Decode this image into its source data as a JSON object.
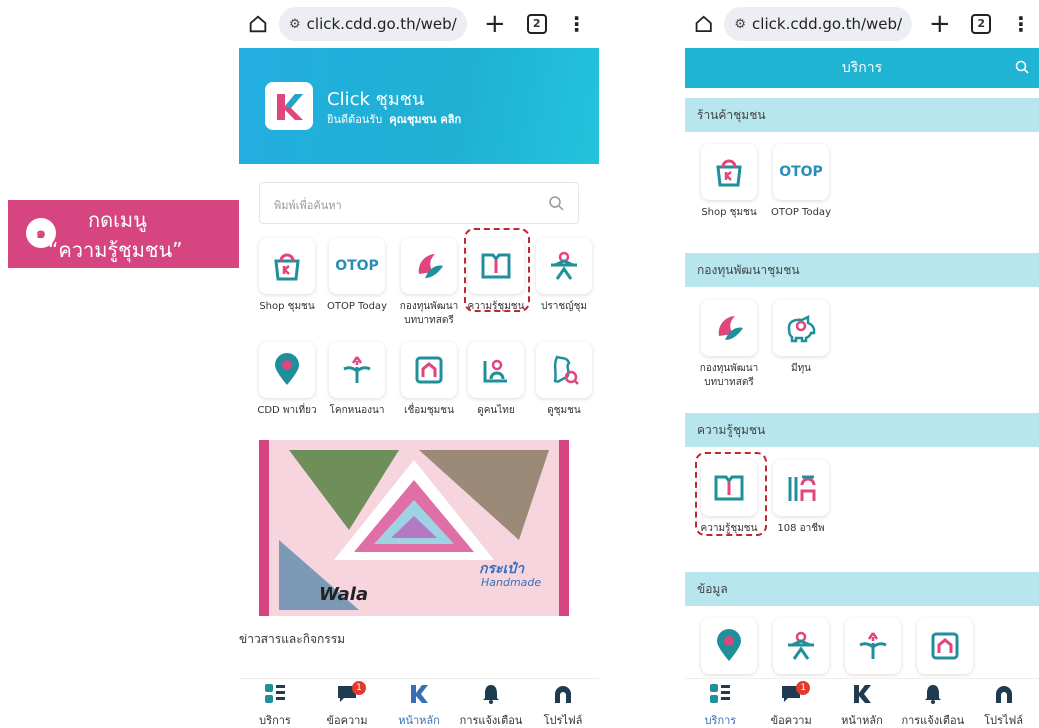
{
  "annotation": {
    "step": "๑",
    "line1": "กดเมนู",
    "line2": "“ความรู้ชุมชน”"
  },
  "browser": {
    "url": "click.cdd.go.th/web/",
    "tab_count": "2"
  },
  "home": {
    "app_title": "Click ชุมชน",
    "welcome_prefix": "ยินดีต้อนรับ",
    "welcome_user": "คุณชุมชน คลิก",
    "search_placeholder": "พิมพ์เพื่อค้นหา",
    "row1": [
      "Shop ชุมชน",
      "OTOP Today",
      "กองทุนพัฒนา",
      "ความรู้ชุมชน",
      "ปราชญ์ชุม"
    ],
    "row1_sub": "บทบาทสตรี",
    "row2": [
      "CDD พาเที่ยว",
      "โคกหนองนา",
      "เชื่อมชุมชน",
      "ดูคนไทย",
      "ดูชุมชน"
    ],
    "news_title": "ข่าวสารและกิจกรรม",
    "banner_text1": "กระเป๋า",
    "banner_text2": "Handmade",
    "banner_text3": "Wala"
  },
  "services": {
    "header": "บริการ",
    "sections": [
      "ร้านค้าชุมชน",
      "กองทุนพัฒนาชุมชน",
      "ความรู้ชุมชน",
      "ข้อมูล"
    ],
    "shop_items": [
      "Shop ชุมชน",
      "OTOP Today"
    ],
    "fund_items": [
      "กองทุนพัฒนา",
      "มีทุน"
    ],
    "fund_sub": "บทบาทสตรี",
    "knowledge_items": [
      "ความรู้ชุมชน",
      "108 อาชีพ"
    ]
  },
  "nav": [
    "บริการ",
    "ข้อความ",
    "หน้าหลัก",
    "การแจ้งเตือน",
    "โปรไฟล์"
  ],
  "message_badge": "1",
  "otop_logo": "OTOP",
  "colors": {
    "accent": "#1fb3d4",
    "pink": "#d6457f",
    "highlight": "#c0282e",
    "icon_pink": "#e0467e",
    "icon_teal": "#1f8f9a"
  }
}
